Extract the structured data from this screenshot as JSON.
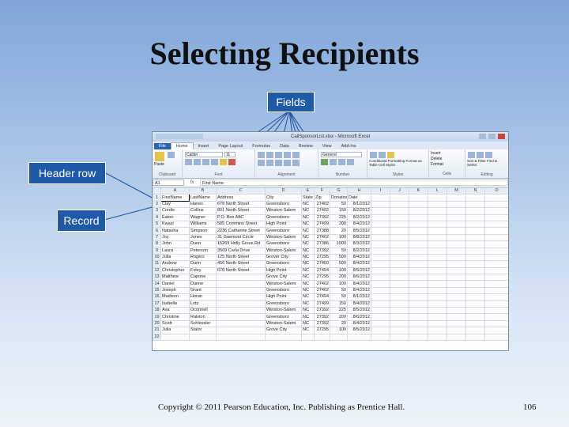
{
  "slide": {
    "title": "Selecting Recipients",
    "callouts": {
      "fields": "Fields",
      "header_row": "Header row",
      "record": "Record"
    },
    "copyright": "Copyright © 2011 Pearson Education, Inc. Publishing as Prentice Hall.",
    "page_number": "106"
  },
  "excel": {
    "window_title": "CallSponsorList.xlsx - Microsoft Excel",
    "tabs": [
      "File",
      "Home",
      "Insert",
      "Page Layout",
      "Formulas",
      "Data",
      "Review",
      "View",
      "Add-Ins"
    ],
    "active_tab": "Home",
    "ribbon": {
      "paste": "Paste",
      "font_name": "Calibri",
      "font_size": "11",
      "number_format": "General",
      "conditional_formatting": "Conditional Formatting",
      "format_as_table": "Format as Table",
      "cell_styles": "Cell Styles",
      "insert": "Insert",
      "delete": "Delete",
      "format": "Format",
      "sort_filter": "Sort & Filter",
      "find_select": "Find & Select",
      "groups": [
        "Clipboard",
        "Font",
        "Alignment",
        "Number",
        "Styles",
        "Cells",
        "Editing"
      ]
    },
    "name_box": "A1",
    "fx": "fx",
    "formula_value": "First Name",
    "columns": [
      "A",
      "B",
      "C",
      "D",
      "E",
      "F",
      "G",
      "H",
      "I",
      "J",
      "K",
      "L",
      "M",
      "N",
      "O"
    ],
    "header": [
      "FirstName",
      "LastName",
      "Address",
      "City",
      "State",
      "Zip",
      "Donation",
      "Date"
    ],
    "rows": [
      [
        "Clay",
        "Hanes",
        "678 North Street",
        "Greensboro",
        "NC",
        "27402",
        "50",
        "8/1/2012"
      ],
      [
        "Cordie",
        "Collins",
        "801 North Street",
        "Winston-Salem",
        "NC",
        "27492",
        "150",
        "8/2/2012"
      ],
      [
        "Eaton",
        "Wagner",
        "P.O. Box ABC",
        "Greensboro",
        "NC",
        "27392",
        "225",
        "8/2/2012"
      ],
      [
        "Kwasi",
        "Williams",
        "585 Commins Street",
        "High Point",
        "NC",
        "27499",
        "200",
        "8/4/2012"
      ],
      [
        "Natasha",
        "Simpson",
        "2236 Cathanne Street",
        "Greensboro",
        "NC",
        "27388",
        "20",
        "8/5/2012"
      ],
      [
        "Joy",
        "Jones",
        "31 Gaemont Circle",
        "Winston-Salem",
        "NC",
        "27402",
        "100",
        "8/8/2012"
      ],
      [
        "John",
        "Dunn",
        "15209 Holly Grove Rd",
        "Greensboro",
        "NC",
        "27386",
        "1000",
        "8/3/2012"
      ],
      [
        "Laura",
        "Peterson",
        "3509 Carla Drive",
        "Winston-Salem",
        "NC",
        "27392",
        "50",
        "8/2/2012"
      ],
      [
        "Julia",
        "Rogers",
        "125 North Street",
        "Grover City",
        "NC",
        "27295",
        "500",
        "8/4/2012"
      ],
      [
        "Andrew",
        "Dunn",
        "456 North Street",
        "Greensboro",
        "NC",
        "27450",
        "500",
        "8/4/2012"
      ],
      [
        "Christopher",
        "Foley",
        "678 North Street",
        "High Point",
        "NC",
        "27494",
        "100",
        "8/5/2012"
      ],
      [
        "Matthew",
        "Capone",
        "",
        "Grove City",
        "NC",
        "27295",
        "200",
        "8/6/2012"
      ],
      [
        "Daniel",
        "Dunne",
        "",
        "Winston-Salem",
        "NC",
        "27402",
        "100",
        "8/4/2012"
      ],
      [
        "Joseph",
        "Grant",
        "",
        "Greensboro",
        "NC",
        "27402",
        "50",
        "8/4/2012"
      ],
      [
        "Madison",
        "Horan",
        "",
        "High Point",
        "NC",
        "27494",
        "50",
        "8/1/2012"
      ],
      [
        "Isabella",
        "Lotz",
        "",
        "Greensboro",
        "NC",
        "27499",
        "150",
        "8/4/2012"
      ],
      [
        "Ava",
        "Oconnell",
        "",
        "Winston-Salem",
        "NC",
        "27392",
        "225",
        "8/5/2012"
      ],
      [
        "Christine",
        "Ralston",
        "",
        "Greensboro",
        "NC",
        "27392",
        "200",
        "8/6/2012"
      ],
      [
        "Scott",
        "Schlessler",
        "",
        "Winston-Salem",
        "NC",
        "27392",
        "20",
        "8/4/2012"
      ],
      [
        "Julia",
        "Stalor",
        "",
        "Grove City",
        "NC",
        "27295",
        "100",
        "8/5/2012"
      ]
    ],
    "empty_row_numbers": [
      "22"
    ]
  },
  "colors": {
    "callout_bg": "#1f5aa8",
    "line": "#1f4f9a",
    "file_tab": "#2a64b4"
  }
}
